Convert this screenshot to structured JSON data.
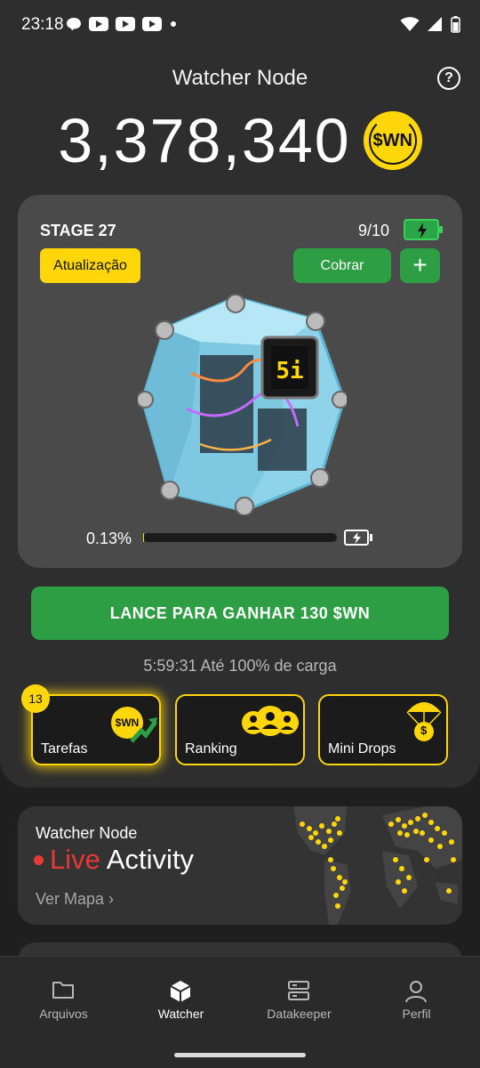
{
  "status_bar": {
    "time": "23:18"
  },
  "header": {
    "title": "Watcher Node"
  },
  "balance": {
    "value": "3,378,340",
    "coin_label": "$WN"
  },
  "stage": {
    "label": "STAGE 27",
    "battery_count": "9/10",
    "upgrade_label": "Atualização",
    "collect_label": "Cobrar",
    "add_label": "+",
    "progress_text": "0.13%",
    "progress_value": 0.0013
  },
  "launch_button": "LANCE PARA GANHAR 130 $WN",
  "charge_timer": "5:59:31 Até 100% de carga",
  "features": {
    "tasks": {
      "label": "Tarefas",
      "badge": "13",
      "coin_label": "$WN"
    },
    "ranking": {
      "label": "Ranking"
    },
    "mini_drops": {
      "label": "Mini Drops",
      "coin_symbol": "$"
    }
  },
  "live_activity": {
    "eyebrow": "Watcher Node",
    "title_live": "Live",
    "title_rest": "Activity",
    "map_link": "Ver Mapa ›"
  },
  "nav": {
    "files": "Arquivos",
    "watcher": "Watcher",
    "datakeeper": "Datakeeper",
    "profile": "Perfil"
  },
  "colors": {
    "accent_yellow": "#ffd60a",
    "accent_green": "#2e9e44",
    "live_red": "#e53935",
    "card_bg": "#4a4a4a",
    "page_bg": "#1f1f1f"
  }
}
